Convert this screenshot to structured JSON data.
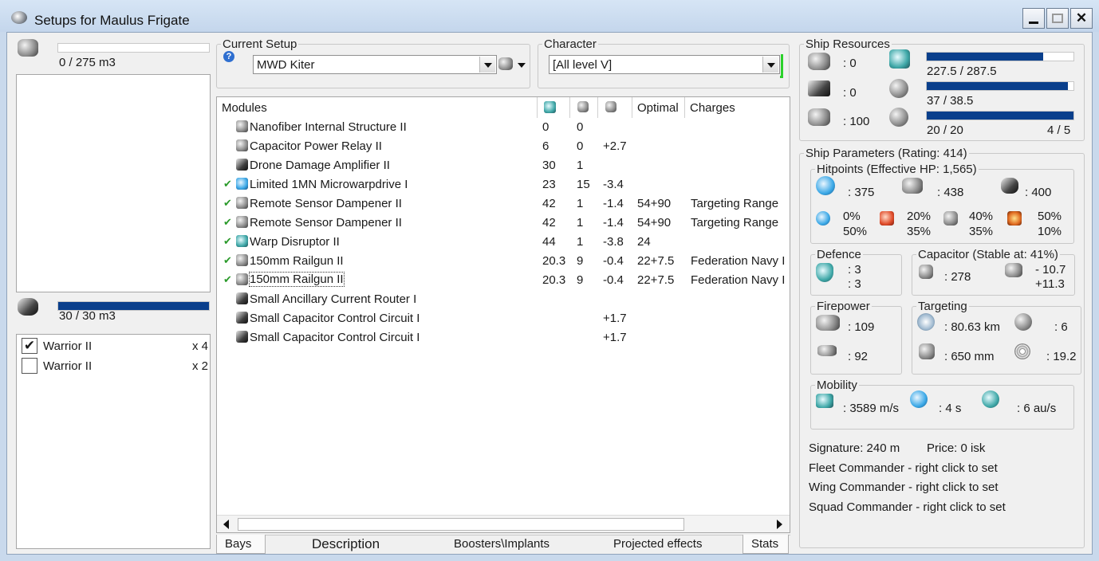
{
  "window": {
    "title": "Setups for Maulus Frigate"
  },
  "cargo": {
    "text": "0 / 275 m3",
    "fill": 0.0
  },
  "drone_bay": {
    "text": "30 / 30 m3",
    "fill": 1.0,
    "drones": [
      {
        "name": "Warrior II",
        "qty": "x 4",
        "checked": true
      },
      {
        "name": "Warrior II",
        "qty": "x 2",
        "checked": false
      }
    ]
  },
  "current_setup": {
    "legend": "Current Setup",
    "value": "MWD Kiter",
    "help": "?"
  },
  "character": {
    "legend": "Character",
    "value": "[All level V]"
  },
  "modules": {
    "headers": [
      "Modules",
      "",
      "",
      "",
      "Optimal",
      "Charges"
    ],
    "rows": [
      {
        "check": "",
        "name": "Nanofiber Internal Structure II",
        "cpu": "0",
        "pg": "0",
        "cap": "",
        "optimal": "",
        "charges": "",
        "icon": "gray"
      },
      {
        "check": "",
        "name": "Capacitor Power Relay II",
        "cpu": "6",
        "pg": "0",
        "cap": "+2.7",
        "optimal": "",
        "charges": "",
        "icon": "gray"
      },
      {
        "check": "",
        "name": "Drone Damage Amplifier II",
        "cpu": "30",
        "pg": "1",
        "cap": "",
        "optimal": "",
        "charges": "",
        "icon": "dark"
      },
      {
        "check": "✔",
        "name": "Limited 1MN Microwarpdrive I",
        "cpu": "23",
        "pg": "15",
        "cap": "-3.4",
        "optimal": "",
        "charges": "",
        "icon": "blue"
      },
      {
        "check": "✔",
        "name": "Remote Sensor Dampener II",
        "cpu": "42",
        "pg": "1",
        "cap": "-1.4",
        "optimal": "54+90",
        "charges": "Targeting Range",
        "icon": "gray"
      },
      {
        "check": "✔",
        "name": "Remote Sensor Dampener II",
        "cpu": "42",
        "pg": "1",
        "cap": "-1.4",
        "optimal": "54+90",
        "charges": "Targeting Range",
        "icon": "gray"
      },
      {
        "check": "✔",
        "name": "Warp Disruptor II",
        "cpu": "44",
        "pg": "1",
        "cap": "-3.8",
        "optimal": "24",
        "charges": "",
        "icon": "teal"
      },
      {
        "check": "✔",
        "name": "150mm Railgun II",
        "cpu": "20.3",
        "pg": "9",
        "cap": "-0.4",
        "optimal": "22+7.5",
        "charges": "Federation Navy I",
        "icon": "gray"
      },
      {
        "check": "✔",
        "name": "150mm Railgun II",
        "cpu": "20.3",
        "pg": "9",
        "cap": "-0.4",
        "optimal": "22+7.5",
        "charges": "Federation Navy I",
        "icon": "gray"
      },
      {
        "check": "",
        "name": "Small Ancillary Current Router I",
        "cpu": "",
        "pg": "",
        "cap": "",
        "optimal": "",
        "charges": "",
        "icon": "dark"
      },
      {
        "check": "",
        "name": "Small Capacitor Control Circuit I",
        "cpu": "",
        "pg": "",
        "cap": "+1.7",
        "optimal": "",
        "charges": "",
        "icon": "dark"
      },
      {
        "check": "",
        "name": "Small Capacitor Control Circuit I",
        "cpu": "",
        "pg": "",
        "cap": "+1.7",
        "optimal": "",
        "charges": "",
        "icon": "dark"
      }
    ]
  },
  "bottom_tabs": [
    "Bays",
    "Description",
    "Boosters\\Implants",
    "Projected effects",
    "Stats"
  ],
  "ship_resources": {
    "legend": "Ship Resources",
    "hardpoints": [
      ": 0",
      ": 0",
      ": 100"
    ],
    "cpu": {
      "text": "227.5 / 287.5",
      "fill": 0.791
    },
    "powergrid": {
      "text": "37 / 38.5",
      "fill": 0.961
    },
    "calibration": {
      "left": "20 / 20",
      "right": "4 / 5",
      "fill": 1.0
    }
  },
  "ship_parameters": {
    "legend": "Ship Parameters (Rating: 414)",
    "hitpoints": {
      "legend": "Hitpoints (Effective HP: 1,565)",
      "shield": ": 375",
      "armor": ": 438",
      "structure": ": 400",
      "res": [
        {
          "a": "0%",
          "b": "50%"
        },
        {
          "a": "20%",
          "b": "35%"
        },
        {
          "a": "40%",
          "b": "35%"
        },
        {
          "a": "50%",
          "b": "10%"
        }
      ]
    },
    "defence": {
      "legend": "Defence",
      "v1": ": 3",
      "v2": ": 3"
    },
    "capacitor": {
      "legend": "Capacitor (Stable at: 41%)",
      "amount": ": 278",
      "v1": "- 10.7",
      "v2": "+11.3"
    },
    "firepower": {
      "legend": "Firepower",
      "v1": ": 109",
      "v2": ": 92"
    },
    "targeting": {
      "legend": "Targeting",
      "range": ": 80.63 km",
      "targets": ": 6",
      "res": ": 650 mm",
      "sensor": ": 19.2"
    },
    "mobility": {
      "legend": "Mobility",
      "speed": ": 3589 m/s",
      "align": ": 4 s",
      "warp": ": 6 au/s"
    },
    "signature": "Signature: 240 m",
    "price": "Price: 0 isk",
    "fleet": "Fleet Commander - right click to set",
    "wing": "Wing Commander - right click to set",
    "squad": "Squad Commander - right click to set"
  }
}
